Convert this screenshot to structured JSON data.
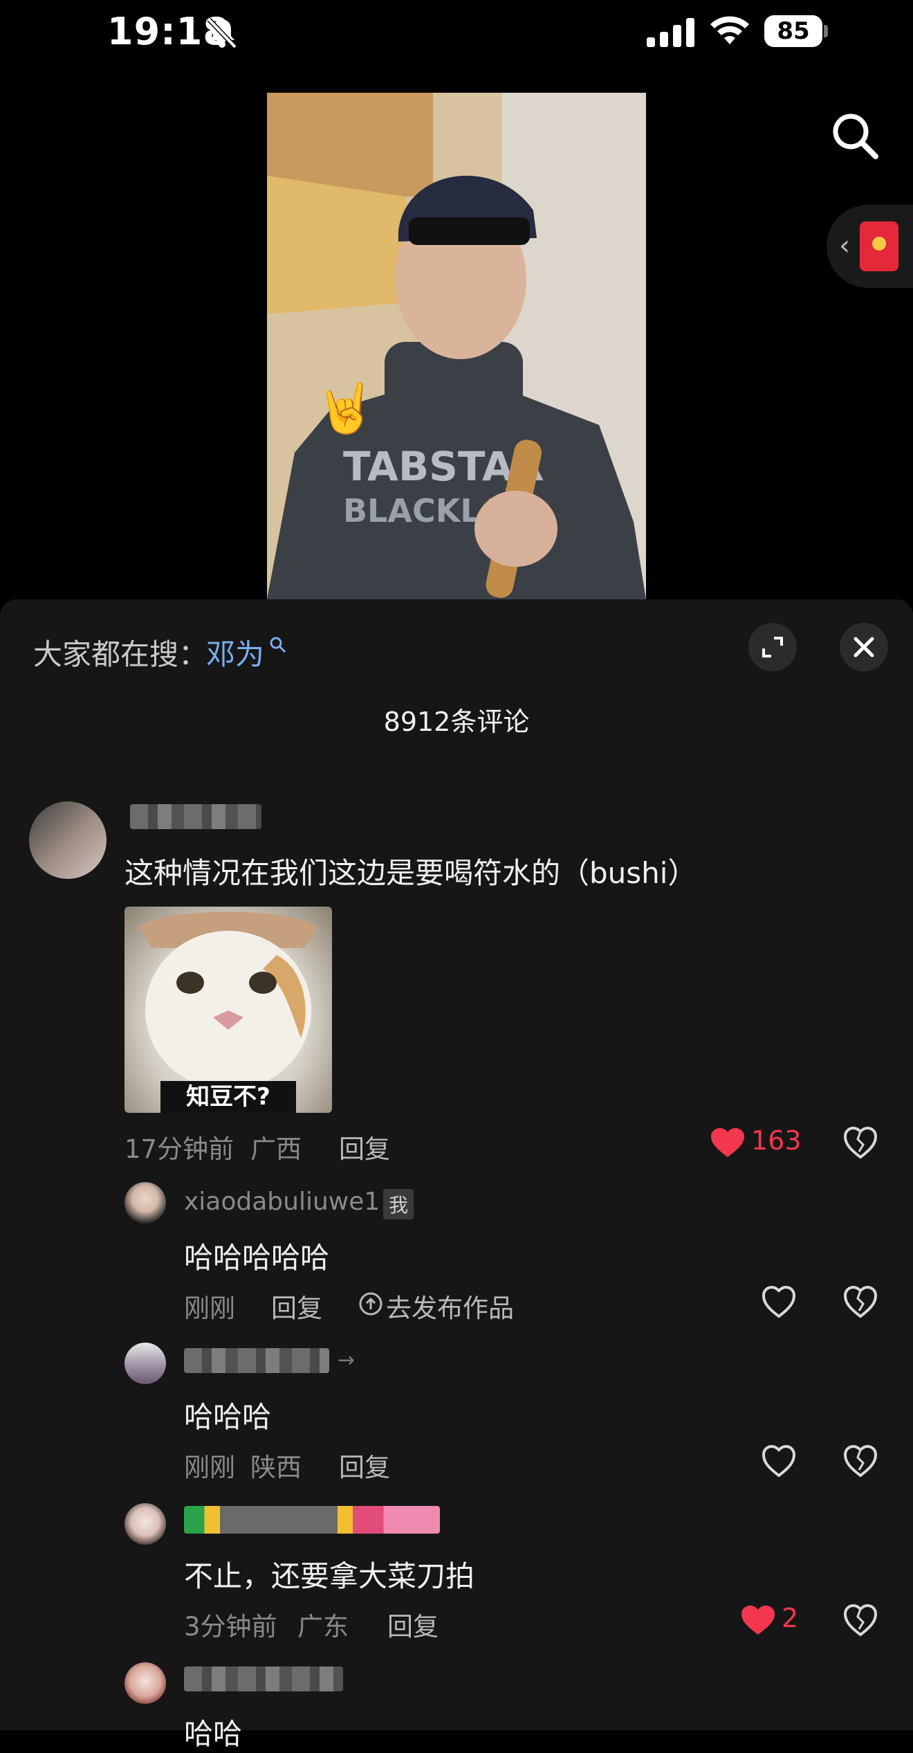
{
  "status_bar": {
    "time": "19:18",
    "battery": "85",
    "icons": [
      "bell-muted-icon",
      "cellular-signal-icon",
      "wifi-icon",
      "battery-icon"
    ]
  },
  "video": {
    "icons": [
      "search-icon",
      "red-envelope-icon"
    ]
  },
  "comments_panel": {
    "trending_label": "大家都在搜：",
    "trending_term": "邓为",
    "count_title": "8912条评论",
    "colors": {
      "background": "#161616",
      "link": "#7aaef2",
      "like_red": "#f2374f"
    }
  },
  "comments": [
    {
      "text": "这种情况在我们这边是要喝符水的（bushi）",
      "sticker_caption": "知豆不?",
      "time": "17分钟前",
      "location": "广西",
      "reply": "回复",
      "likes": "163",
      "liked": true
    },
    {
      "username": "xiaodabuliuwe1",
      "badge": "我",
      "text": "哈哈哈哈哈",
      "time": "刚刚",
      "reply": "回复",
      "publish_link": "去发布作品",
      "liked": false
    },
    {
      "text": "哈哈哈",
      "time": "刚刚",
      "location": "陕西",
      "reply": "回复",
      "liked": false
    },
    {
      "text": "不止，还要拿大菜刀拍",
      "time": "3分钟前",
      "location": "广东",
      "reply": "回复",
      "likes": "2",
      "liked": true
    },
    {
      "text": "哈哈"
    }
  ]
}
